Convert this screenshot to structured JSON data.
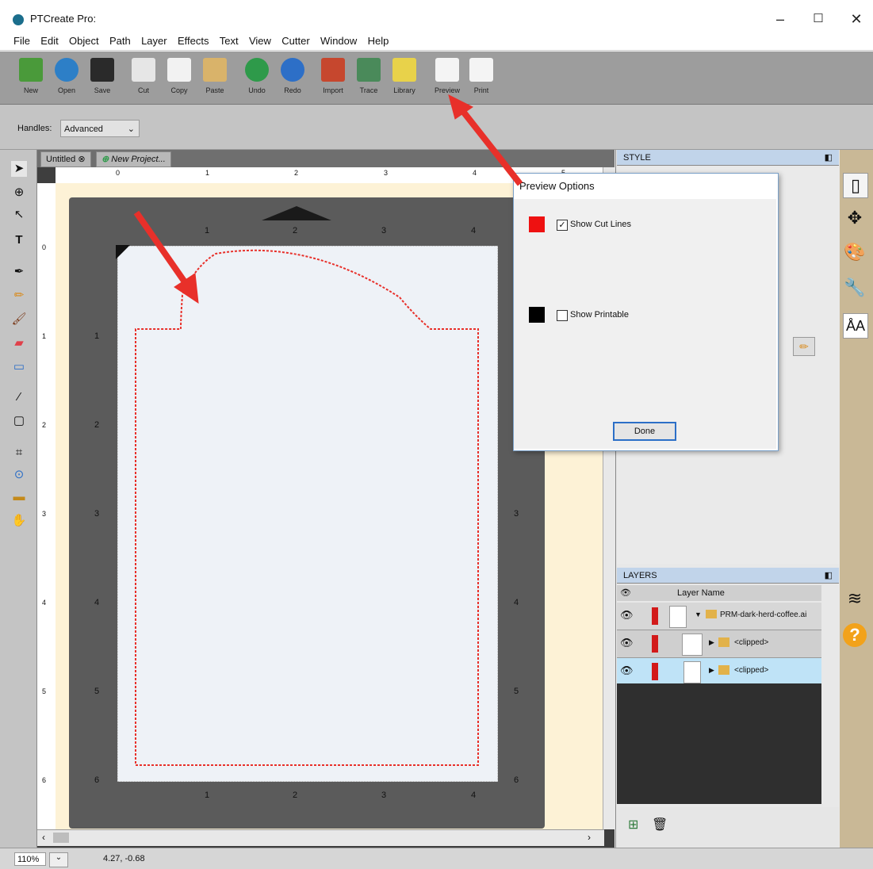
{
  "window": {
    "title": "PTCreate Pro:",
    "minimize": "–",
    "maximize": "☐",
    "close": "✕"
  },
  "menu": [
    "File",
    "Edit",
    "Object",
    "Path",
    "Layer",
    "Effects",
    "Text",
    "View",
    "Cutter",
    "Window",
    "Help"
  ],
  "toolbar": [
    {
      "label": "New",
      "color": "#4a9a3a"
    },
    {
      "label": "Open",
      "color": "#2d7fc7"
    },
    {
      "label": "Save",
      "color": "#2a2a2a"
    },
    {
      "label": "Cut",
      "color": "#e6e6e6"
    },
    {
      "label": "Copy",
      "color": "#f2f2f2"
    },
    {
      "label": "Paste",
      "color": "#d9b36a"
    },
    {
      "label": "Undo",
      "color": "#2e9a4a"
    },
    {
      "label": "Redo",
      "color": "#2d6fc7"
    },
    {
      "label": "Import",
      "color": "#c6472e"
    },
    {
      "label": "Trace",
      "color": "#4a8a5a"
    },
    {
      "label": "Library",
      "color": "#e8d24a"
    },
    {
      "label": "Preview",
      "color": "#f4f4f4"
    },
    {
      "label": "Print",
      "color": "#f4f4f4"
    }
  ],
  "options": {
    "handles_label": "Handles:",
    "handles_value": "Advanced"
  },
  "tabs": {
    "untitled": "Untitled",
    "new_project": "New Project..."
  },
  "rulers": {
    "top": [
      "0",
      "1",
      "2",
      "3",
      "4",
      "5"
    ],
    "mat_top": [
      "1",
      "2",
      "3",
      "4"
    ],
    "mat_side": [
      "1",
      "2",
      "3",
      "4",
      "5",
      "6"
    ],
    "left": [
      "0",
      "1",
      "2",
      "3",
      "4",
      "5",
      "6"
    ]
  },
  "style_panel": {
    "title": "STYLE"
  },
  "layers_panel": {
    "title": "LAYERS",
    "col_header": "Layer Name",
    "rows": [
      {
        "name": "PRM-dark-herd-coffee.ai",
        "selected": false
      },
      {
        "name": "<clipped>",
        "selected": false
      },
      {
        "name": "<clipped>",
        "selected": true
      }
    ]
  },
  "dialog": {
    "title": "Preview Options",
    "show_cut_lines": "Show Cut Lines",
    "cut_checked": "✓",
    "cut_color": "#ee1111",
    "show_printable": "Show Printable",
    "print_color": "#000000",
    "done": "Done"
  },
  "status": {
    "zoom": "110%",
    "coords": "4.27, -0.68"
  },
  "accent": {
    "arrow": "#e8302a",
    "cutline": "#e8302a",
    "selected_row": "#bfe3f7"
  }
}
